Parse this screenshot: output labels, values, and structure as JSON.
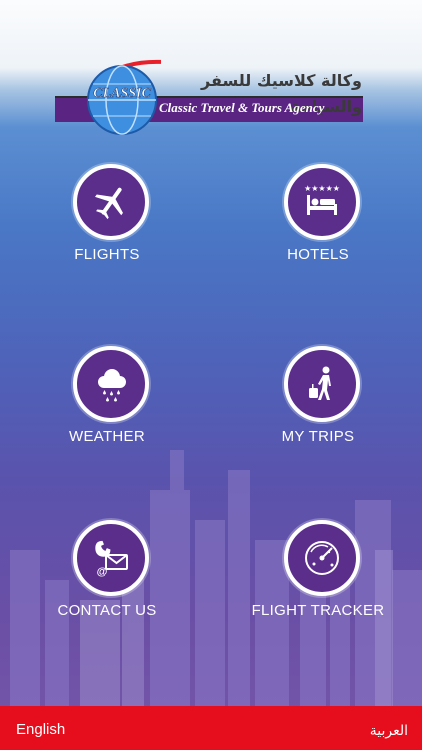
{
  "header": {
    "logo_text": "CLASSIC",
    "arabic_name": "وكالة كلاسيك للسفر والسياحة",
    "english_name": "Classic Travel & Tours Agency"
  },
  "menu": {
    "flights": {
      "label": "FLIGHTS",
      "icon": "airplane-icon"
    },
    "hotels": {
      "label": "HOTELS",
      "icon": "hotel-bed-icon"
    },
    "weather": {
      "label": "WEATHER",
      "icon": "rain-cloud-icon"
    },
    "my_trips": {
      "label": "MY TRIPS",
      "icon": "traveler-luggage-icon"
    },
    "contact_us": {
      "label": "CONTACT US",
      "icon": "phone-envelope-icon"
    },
    "flight_tracker": {
      "label": "FLIGHT TRACKER",
      "icon": "radar-icon"
    }
  },
  "footer": {
    "english": "English",
    "arabic": "العربية"
  },
  "colors": {
    "accent_purple": "#5b2e8c",
    "footer_red": "#e60e1c",
    "banner_purple": "#5a2582"
  }
}
